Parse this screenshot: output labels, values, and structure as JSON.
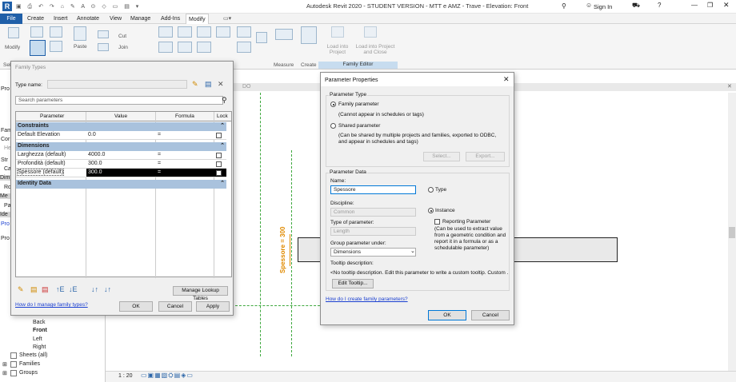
{
  "window": {
    "title": "Autodesk Revit 2020 - STUDENT VERSION - MTT e AMZ - Trave - Elevation: Front",
    "sign_in": "Sign In"
  },
  "tabs": [
    "File",
    "Create",
    "Insert",
    "Annotate",
    "View",
    "Manage",
    "Add-Ins",
    "Modify"
  ],
  "ribbon": {
    "paste_label": "Paste",
    "cut_label": "Cut",
    "join_label": "Join",
    "modify_label": "Modify",
    "load_into_project": "Load into Project",
    "load_into_project_close": "Load into Project and Close",
    "panel_measure": "Measure",
    "panel_create": "Create",
    "panel_family_editor": "Family Editor",
    "select_stub": "Sel"
  },
  "family_types": {
    "title": "Family Types",
    "type_name_label": "Type name:",
    "search_placeholder": "Search parameters",
    "columns": [
      "Parameter",
      "Value",
      "Formula",
      "Lock"
    ],
    "groups": [
      {
        "name": "Constraints",
        "rows": [
          {
            "param": "Default Elevation",
            "value": "0.0",
            "formula": "="
          }
        ]
      },
      {
        "name": "Dimensions",
        "rows": [
          {
            "param": "Larghezza (default)",
            "value": "4000.0",
            "formula": "="
          },
          {
            "param": "Profondità (default)",
            "value": "300.0",
            "formula": "="
          },
          {
            "param": "Spessore (default)",
            "value": "300.0",
            "formula": "="
          }
        ]
      },
      {
        "name": "Identity Data",
        "rows": []
      }
    ],
    "manage_lookup": "Manage Lookup Tables",
    "help_link": "How do I manage family types?",
    "ok": "OK",
    "cancel": "Cancel",
    "apply": "Apply"
  },
  "param_props": {
    "title": "Parameter Properties",
    "type_section": "Parameter Type",
    "family_param": "Family parameter",
    "family_param_desc": "(Cannot appear in schedules or tags)",
    "shared_param": "Shared parameter",
    "shared_param_desc": "(Can be shared by multiple projects and families, exported to ODBC, and appear in schedules and tags)",
    "select_btn": "Select...",
    "export_btn": "Export...",
    "data_section": "Parameter Data",
    "name_label": "Name:",
    "name_value": "Spessore",
    "type_radio": "Type",
    "instance_radio": "Instance",
    "discipline_label": "Discipline:",
    "discipline_value": "Common",
    "type_of_param_label": "Type of parameter:",
    "type_of_param_value": "Length",
    "reporting": "Reporting Parameter",
    "reporting_desc": "(Can be used to extract value from a geometric condition and report it in a formula or as a schedulable parameter)",
    "group_label": "Group parameter under:",
    "group_value": "Dimensions",
    "tooltip_label": "Tooltip description:",
    "tooltip_value": "<No tooltip description. Edit this parameter to write a custom tooltip. Custom ...",
    "edit_tooltip": "Edit Tooltip...",
    "help_link": "How do I create family parameters?",
    "ok": "OK",
    "cancel": "Cancel"
  },
  "browser": {
    "items": [
      "Back",
      "Front",
      "Left",
      "Right",
      "Sheets (all)",
      "Families",
      "Groups"
    ],
    "side_stub": [
      "Pro",
      "Fam",
      "Cor",
      "He",
      "Str",
      "Ca",
      "Dim",
      "Ro",
      "Me",
      "Pa",
      "Ide",
      "Pro",
      "Pro"
    ]
  },
  "canvas": {
    "dimension_label": "Spessore = 300",
    "scale": "1 : 20",
    "tab_label": "DO"
  }
}
